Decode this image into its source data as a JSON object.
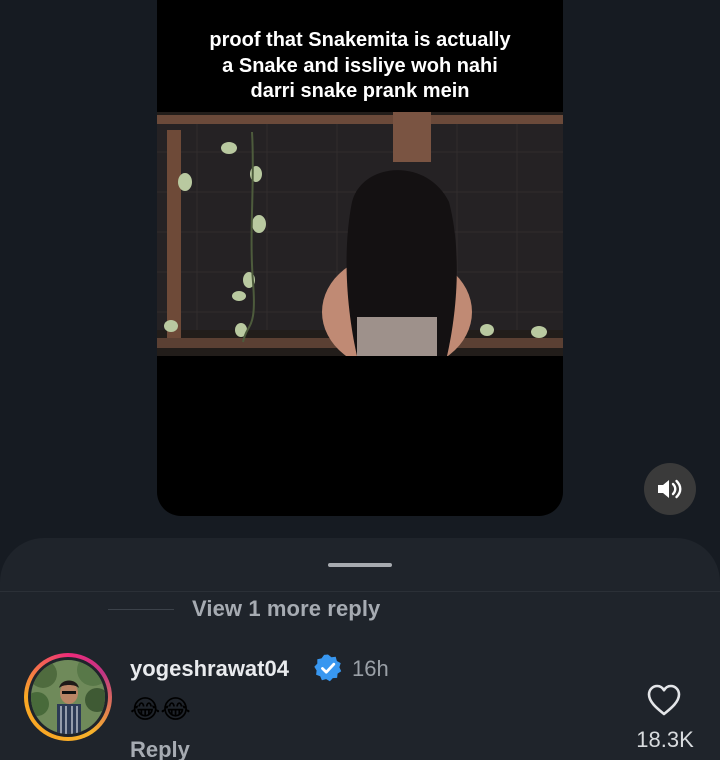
{
  "video": {
    "caption_lines": [
      "proof that Snakemita is actually",
      "a Snake and issliye woh nahi",
      "darri snake prank mein"
    ],
    "sound_icon": "speaker-volume-icon"
  },
  "comments": {
    "view_more_label": "View 1 more reply",
    "reply": {
      "username": "yogeshrawat04",
      "verified": true,
      "timestamp": "16h",
      "text": "😂😂",
      "reply_label": "Reply",
      "like_count": "18.3K"
    }
  },
  "colors": {
    "background": "#161b22",
    "sheet": "#1f242b",
    "verified_badge": "#3897f0"
  }
}
